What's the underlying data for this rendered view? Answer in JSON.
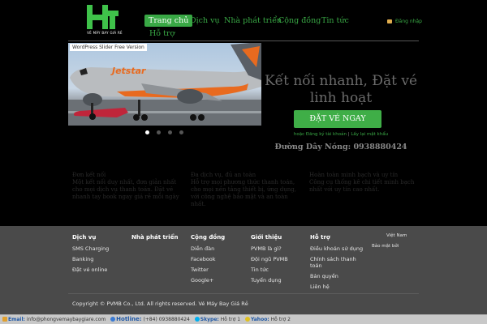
{
  "header": {
    "logo_text": "VÉ MÁY BAY GIÁ RẺ",
    "nav": [
      {
        "label": "Trang chủ",
        "active": true
      },
      {
        "label": "Dịch vụ"
      },
      {
        "label": "Nhà phát triển"
      },
      {
        "label": "Cộng đồng"
      },
      {
        "label": "Tin tức"
      },
      {
        "label": "Hỗ trợ"
      }
    ],
    "login": "Đăng nhập"
  },
  "slider": {
    "tag": "WordPress Slider Free Version",
    "airline_mark": "Jetstar",
    "slides": 4,
    "active_slide": 1
  },
  "hero": {
    "title": "Kết nối nhanh, Đặt vé linh hoạt",
    "cta": "ĐẶT VÉ NGAY",
    "register": "hoặc Đăng ký tài khoản",
    "separator": "|",
    "recover": "Lấy lại mật khẩu",
    "hotline": "Đường Dây Nóng: 0938880424"
  },
  "features": [
    {
      "title": "Đơn kết nối",
      "text": "Một kết nối duy nhất, đơn giản nhất cho mọi dịch vụ thanh toán. Đặt vé nhanh tay book ngay giá rẻ mỗi ngày"
    },
    {
      "title": "Đa dịch vụ, đủ an toàn",
      "text": "Hỗ trợ mọi phương thức thanh toán, cho mọi nền tảng thiết bị, ứng dụng, với công nghệ bảo mật và an toàn nhất."
    },
    {
      "title": "Hoàn toàn minh bạch và uy tín",
      "text": "Công cụ thống kê chi tiết minh bạch nhất với uy tín cao nhất."
    }
  ],
  "footer": {
    "columns": [
      {
        "title": "Dịch vụ",
        "links": [
          "SMS Charging",
          "Banking",
          "Đặt vé online"
        ]
      },
      {
        "title": "Nhà phát triển",
        "links": []
      },
      {
        "title": "Cộng đồng",
        "links": [
          "Diễn đàn",
          "Facebook",
          "Twitter",
          "Google+"
        ]
      },
      {
        "title": "Giới thiệu",
        "links": [
          "PVMB là gì?",
          "Đội ngũ PVMB",
          "Tin tức",
          "Tuyển dụng"
        ]
      },
      {
        "title": "Hỗ trợ",
        "links": [
          "Điều khoản sử dụng",
          "Chính sách thanh toán",
          "Bản quyền",
          "Liên hệ"
        ]
      }
    ],
    "side_lang": "Việt Nam",
    "side_security": "Bảo mật bởi",
    "copyright": "Copyright © PVMB Co., Ltd. All rights reserved. Vé Máy Bay Giá Rẻ"
  },
  "bottombar": {
    "email_label": "Email:",
    "email": "info@phongvemaybaygiare.com",
    "hotline_label": "Hotline:",
    "hotline": "(+84) 0938880424",
    "skype_label": "Skype:",
    "skype": "Hỗ trợ 1",
    "yahoo_label": "Yahoo:",
    "yahoo": "Hỗ trợ 2"
  },
  "colors": {
    "accent": "#39a845",
    "footer_bg": "#4a4a4a",
    "background": "#000000"
  }
}
